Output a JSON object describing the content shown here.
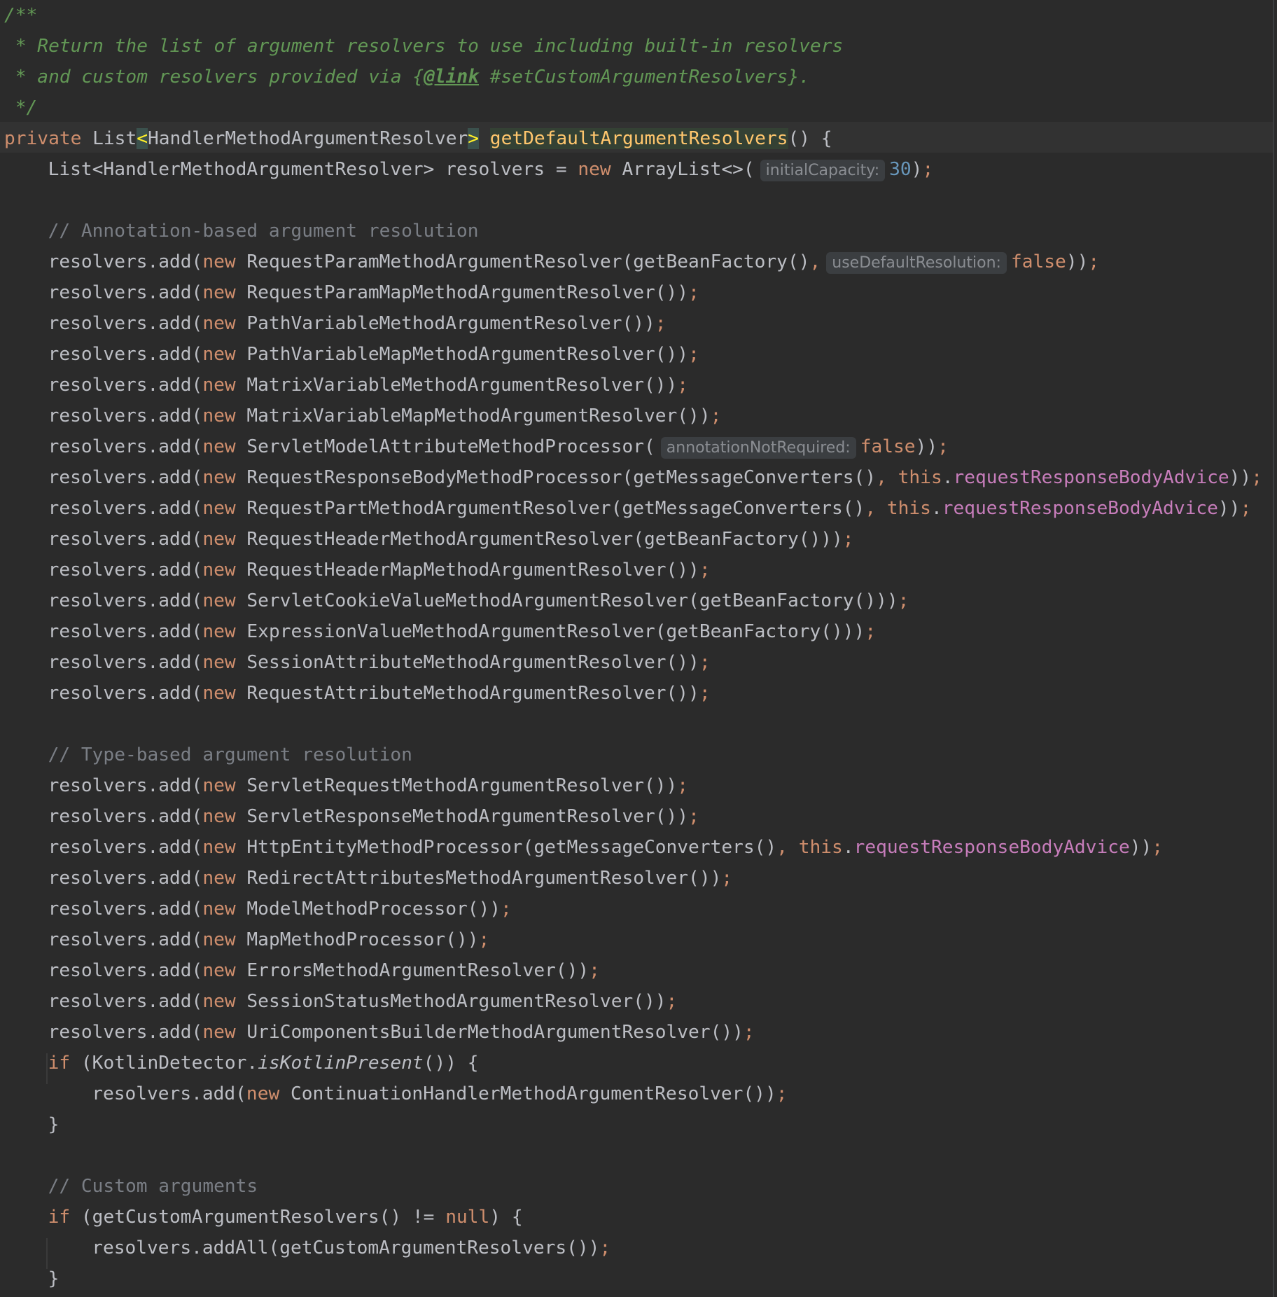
{
  "colors": {
    "background": "#2b2b2b",
    "keyword": "#cf8e6d",
    "field": "#c77dbb",
    "number": "#6897bb",
    "method_declaration": "#ffc66d",
    "comment": "#7a7e85",
    "doc_comment": "#629755",
    "plain": "#bcbec4"
  },
  "lines": [
    {
      "name": "doc-open",
      "indent": 0,
      "tokens": [
        {
          "t": "doc",
          "v": "/**"
        }
      ]
    },
    {
      "name": "doc-line-1",
      "indent": 0,
      "tokens": [
        {
          "t": "doc",
          "v": " * Return the list of argument resolvers to use including built-in resolvers"
        }
      ]
    },
    {
      "name": "doc-line-2",
      "indent": 0,
      "tokens": [
        {
          "t": "doc",
          "v": " * and custom resolvers provided via {"
        },
        {
          "t": "doctag",
          "v": "@link"
        },
        {
          "t": "doc",
          "v": " #setCustomArgumentResolvers}."
        }
      ]
    },
    {
      "name": "doc-close",
      "indent": 0,
      "tokens": [
        {
          "t": "doc",
          "v": " */"
        }
      ]
    },
    {
      "name": "method-signature",
      "indent": 0,
      "tokens": [
        {
          "t": "kw",
          "v": "private "
        },
        {
          "t": "plain",
          "v": "List"
        },
        {
          "t": "bracket",
          "v": "<"
        },
        {
          "t": "plain",
          "v": "HandlerMethodArgumentResolver"
        },
        {
          "t": "bracket",
          "v": ">"
        },
        {
          "t": "plain",
          "v": " "
        },
        {
          "t": "decl",
          "v": "getDefaultArgumentResolvers"
        },
        {
          "t": "plain",
          "v": "() {"
        }
      ]
    },
    {
      "name": "resolvers-declaration",
      "indent": 1,
      "tokens": [
        {
          "t": "plain",
          "v": "List<HandlerMethodArgumentResolver> resolvers = "
        },
        {
          "t": "kw",
          "v": "new "
        },
        {
          "t": "plain",
          "v": "ArrayList<>("
        },
        {
          "t": "hint",
          "v": "initialCapacity:"
        },
        {
          "t": "num",
          "v": "30"
        },
        {
          "t": "plain",
          "v": ")"
        },
        {
          "t": "punct",
          "v": ";"
        }
      ]
    },
    {
      "name": "blank",
      "indent": 0,
      "tokens": []
    },
    {
      "name": "comment-annotation-based",
      "indent": 1,
      "tokens": [
        {
          "t": "lc",
          "v": "// Annotation-based argument resolution"
        }
      ]
    },
    {
      "name": "add-request-param",
      "indent": 1,
      "tokens": [
        {
          "t": "plain",
          "v": "resolvers.add("
        },
        {
          "t": "kw",
          "v": "new "
        },
        {
          "t": "plain",
          "v": "RequestParamMethodArgumentResolver(getBeanFactory()"
        },
        {
          "t": "punct",
          "v": ","
        },
        {
          "t": "hint",
          "v": "useDefaultResolution:"
        },
        {
          "t": "kw",
          "v": "false"
        },
        {
          "t": "plain",
          "v": "))"
        },
        {
          "t": "punct",
          "v": ";"
        }
      ]
    },
    {
      "name": "add-request-param-map",
      "indent": 1,
      "tokens": [
        {
          "t": "plain",
          "v": "resolvers.add("
        },
        {
          "t": "kw",
          "v": "new "
        },
        {
          "t": "plain",
          "v": "RequestParamMapMethodArgumentResolver())"
        },
        {
          "t": "punct",
          "v": ";"
        }
      ]
    },
    {
      "name": "add-path-variable",
      "indent": 1,
      "tokens": [
        {
          "t": "plain",
          "v": "resolvers.add("
        },
        {
          "t": "kw",
          "v": "new "
        },
        {
          "t": "plain",
          "v": "PathVariableMethodArgumentResolver())"
        },
        {
          "t": "punct",
          "v": ";"
        }
      ]
    },
    {
      "name": "add-path-variable-map",
      "indent": 1,
      "tokens": [
        {
          "t": "plain",
          "v": "resolvers.add("
        },
        {
          "t": "kw",
          "v": "new "
        },
        {
          "t": "plain",
          "v": "PathVariableMapMethodArgumentResolver())"
        },
        {
          "t": "punct",
          "v": ";"
        }
      ]
    },
    {
      "name": "add-matrix-variable",
      "indent": 1,
      "tokens": [
        {
          "t": "plain",
          "v": "resolvers.add("
        },
        {
          "t": "kw",
          "v": "new "
        },
        {
          "t": "plain",
          "v": "MatrixVariableMethodArgumentResolver())"
        },
        {
          "t": "punct",
          "v": ";"
        }
      ]
    },
    {
      "name": "add-matrix-variable-map",
      "indent": 1,
      "tokens": [
        {
          "t": "plain",
          "v": "resolvers.add("
        },
        {
          "t": "kw",
          "v": "new "
        },
        {
          "t": "plain",
          "v": "MatrixVariableMapMethodArgumentResolver())"
        },
        {
          "t": "punct",
          "v": ";"
        }
      ]
    },
    {
      "name": "add-servlet-model-attribute",
      "indent": 1,
      "tokens": [
        {
          "t": "plain",
          "v": "resolvers.add("
        },
        {
          "t": "kw",
          "v": "new "
        },
        {
          "t": "plain",
          "v": "ServletModelAttributeMethodProcessor("
        },
        {
          "t": "hint",
          "v": "annotationNotRequired:"
        },
        {
          "t": "kw",
          "v": "false"
        },
        {
          "t": "plain",
          "v": "))"
        },
        {
          "t": "punct",
          "v": ";"
        }
      ]
    },
    {
      "name": "add-request-response-body",
      "indent": 1,
      "tokens": [
        {
          "t": "plain",
          "v": "resolvers.add("
        },
        {
          "t": "kw",
          "v": "new "
        },
        {
          "t": "plain",
          "v": "RequestResponseBodyMethodProcessor(getMessageConverters()"
        },
        {
          "t": "punct",
          "v": ", "
        },
        {
          "t": "kw",
          "v": "this"
        },
        {
          "t": "plain",
          "v": "."
        },
        {
          "t": "field",
          "v": "requestResponseBodyAdvice"
        },
        {
          "t": "plain",
          "v": "))"
        },
        {
          "t": "punct",
          "v": ";"
        }
      ]
    },
    {
      "name": "add-request-part",
      "indent": 1,
      "tokens": [
        {
          "t": "plain",
          "v": "resolvers.add("
        },
        {
          "t": "kw",
          "v": "new "
        },
        {
          "t": "plain",
          "v": "RequestPartMethodArgumentResolver(getMessageConverters()"
        },
        {
          "t": "punct",
          "v": ", "
        },
        {
          "t": "kw",
          "v": "this"
        },
        {
          "t": "plain",
          "v": "."
        },
        {
          "t": "field",
          "v": "requestResponseBodyAdvice"
        },
        {
          "t": "plain",
          "v": "))"
        },
        {
          "t": "punct",
          "v": ";"
        }
      ]
    },
    {
      "name": "add-request-header",
      "indent": 1,
      "tokens": [
        {
          "t": "plain",
          "v": "resolvers.add("
        },
        {
          "t": "kw",
          "v": "new "
        },
        {
          "t": "plain",
          "v": "RequestHeaderMethodArgumentResolver(getBeanFactory()))"
        },
        {
          "t": "punct",
          "v": ";"
        }
      ]
    },
    {
      "name": "add-request-header-map",
      "indent": 1,
      "tokens": [
        {
          "t": "plain",
          "v": "resolvers.add("
        },
        {
          "t": "kw",
          "v": "new "
        },
        {
          "t": "plain",
          "v": "RequestHeaderMapMethodArgumentResolver())"
        },
        {
          "t": "punct",
          "v": ";"
        }
      ]
    },
    {
      "name": "add-servlet-cookie-value",
      "indent": 1,
      "tokens": [
        {
          "t": "plain",
          "v": "resolvers.add("
        },
        {
          "t": "kw",
          "v": "new "
        },
        {
          "t": "plain",
          "v": "ServletCookieValueMethodArgumentResolver(getBeanFactory()))"
        },
        {
          "t": "punct",
          "v": ";"
        }
      ]
    },
    {
      "name": "add-expression-value",
      "indent": 1,
      "tokens": [
        {
          "t": "plain",
          "v": "resolvers.add("
        },
        {
          "t": "kw",
          "v": "new "
        },
        {
          "t": "plain",
          "v": "ExpressionValueMethodArgumentResolver(getBeanFactory()))"
        },
        {
          "t": "punct",
          "v": ";"
        }
      ]
    },
    {
      "name": "add-session-attribute",
      "indent": 1,
      "tokens": [
        {
          "t": "plain",
          "v": "resolvers.add("
        },
        {
          "t": "kw",
          "v": "new "
        },
        {
          "t": "plain",
          "v": "SessionAttributeMethodArgumentResolver())"
        },
        {
          "t": "punct",
          "v": ";"
        }
      ]
    },
    {
      "name": "add-request-attribute",
      "indent": 1,
      "tokens": [
        {
          "t": "plain",
          "v": "resolvers.add("
        },
        {
          "t": "kw",
          "v": "new "
        },
        {
          "t": "plain",
          "v": "RequestAttributeMethodArgumentResolver())"
        },
        {
          "t": "punct",
          "v": ";"
        }
      ]
    },
    {
      "name": "blank",
      "indent": 0,
      "tokens": []
    },
    {
      "name": "comment-type-based",
      "indent": 1,
      "tokens": [
        {
          "t": "lc",
          "v": "// Type-based argument resolution"
        }
      ]
    },
    {
      "name": "add-servlet-request",
      "indent": 1,
      "tokens": [
        {
          "t": "plain",
          "v": "resolvers.add("
        },
        {
          "t": "kw",
          "v": "new "
        },
        {
          "t": "plain",
          "v": "ServletRequestMethodArgumentResolver())"
        },
        {
          "t": "punct",
          "v": ";"
        }
      ]
    },
    {
      "name": "add-servlet-response",
      "indent": 1,
      "tokens": [
        {
          "t": "plain",
          "v": "resolvers.add("
        },
        {
          "t": "kw",
          "v": "new "
        },
        {
          "t": "plain",
          "v": "ServletResponseMethodArgumentResolver())"
        },
        {
          "t": "punct",
          "v": ";"
        }
      ]
    },
    {
      "name": "add-http-entity",
      "indent": 1,
      "tokens": [
        {
          "t": "plain",
          "v": "resolvers.add("
        },
        {
          "t": "kw",
          "v": "new "
        },
        {
          "t": "plain",
          "v": "HttpEntityMethodProcessor(getMessageConverters()"
        },
        {
          "t": "punct",
          "v": ", "
        },
        {
          "t": "kw",
          "v": "this"
        },
        {
          "t": "plain",
          "v": "."
        },
        {
          "t": "field",
          "v": "requestResponseBodyAdvice"
        },
        {
          "t": "plain",
          "v": "))"
        },
        {
          "t": "punct",
          "v": ";"
        }
      ]
    },
    {
      "name": "add-redirect-attributes",
      "indent": 1,
      "tokens": [
        {
          "t": "plain",
          "v": "resolvers.add("
        },
        {
          "t": "kw",
          "v": "new "
        },
        {
          "t": "plain",
          "v": "RedirectAttributesMethodArgumentResolver())"
        },
        {
          "t": "punct",
          "v": ";"
        }
      ]
    },
    {
      "name": "add-model-method",
      "indent": 1,
      "tokens": [
        {
          "t": "plain",
          "v": "resolvers.add("
        },
        {
          "t": "kw",
          "v": "new "
        },
        {
          "t": "plain",
          "v": "ModelMethodProcessor())"
        },
        {
          "t": "punct",
          "v": ";"
        }
      ]
    },
    {
      "name": "add-map-method",
      "indent": 1,
      "tokens": [
        {
          "t": "plain",
          "v": "resolvers.add("
        },
        {
          "t": "kw",
          "v": "new "
        },
        {
          "t": "plain",
          "v": "MapMethodProcessor())"
        },
        {
          "t": "punct",
          "v": ";"
        }
      ]
    },
    {
      "name": "add-errors-method",
      "indent": 1,
      "tokens": [
        {
          "t": "plain",
          "v": "resolvers.add("
        },
        {
          "t": "kw",
          "v": "new "
        },
        {
          "t": "plain",
          "v": "ErrorsMethodArgumentResolver())"
        },
        {
          "t": "punct",
          "v": ";"
        }
      ]
    },
    {
      "name": "add-session-status",
      "indent": 1,
      "tokens": [
        {
          "t": "plain",
          "v": "resolvers.add("
        },
        {
          "t": "kw",
          "v": "new "
        },
        {
          "t": "plain",
          "v": "SessionStatusMethodArgumentResolver())"
        },
        {
          "t": "punct",
          "v": ";"
        }
      ]
    },
    {
      "name": "add-uri-components-builder",
      "indent": 1,
      "tokens": [
        {
          "t": "plain",
          "v": "resolvers.add("
        },
        {
          "t": "kw",
          "v": "new "
        },
        {
          "t": "plain",
          "v": "UriComponentsBuilderMethodArgumentResolver())"
        },
        {
          "t": "punct",
          "v": ";"
        }
      ]
    },
    {
      "name": "if-kotlin-present",
      "indent": 1,
      "tokens": [
        {
          "t": "kw",
          "v": "if "
        },
        {
          "t": "plain",
          "v": "(KotlinDetector."
        },
        {
          "t": "static",
          "v": "isKotlinPresent"
        },
        {
          "t": "plain",
          "v": "()) {"
        }
      ]
    },
    {
      "name": "add-continuation-handler",
      "indent": 2,
      "tokens": [
        {
          "t": "plain",
          "v": "resolvers.add("
        },
        {
          "t": "kw",
          "v": "new "
        },
        {
          "t": "plain",
          "v": "ContinuationHandlerMethodArgumentResolver())"
        },
        {
          "t": "punct",
          "v": ";"
        }
      ]
    },
    {
      "name": "close-if-kotlin",
      "indent": 1,
      "tokens": [
        {
          "t": "plain",
          "v": "}"
        }
      ]
    },
    {
      "name": "blank",
      "indent": 0,
      "tokens": []
    },
    {
      "name": "comment-custom-arguments",
      "indent": 1,
      "tokens": [
        {
          "t": "lc",
          "v": "// Custom arguments"
        }
      ]
    },
    {
      "name": "if-custom-resolvers",
      "indent": 1,
      "tokens": [
        {
          "t": "kw",
          "v": "if "
        },
        {
          "t": "plain",
          "v": "(getCustomArgumentResolvers() != "
        },
        {
          "t": "kw",
          "v": "null"
        },
        {
          "t": "plain",
          "v": ") {"
        }
      ]
    },
    {
      "name": "add-all-custom-resolvers",
      "indent": 2,
      "tokens": [
        {
          "t": "plain",
          "v": "resolvers.addAll(getCustomArgumentResolvers())"
        },
        {
          "t": "punct",
          "v": ";"
        }
      ]
    },
    {
      "name": "close-if-custom",
      "indent": 1,
      "tokens": [
        {
          "t": "plain",
          "v": "}"
        }
      ]
    }
  ]
}
